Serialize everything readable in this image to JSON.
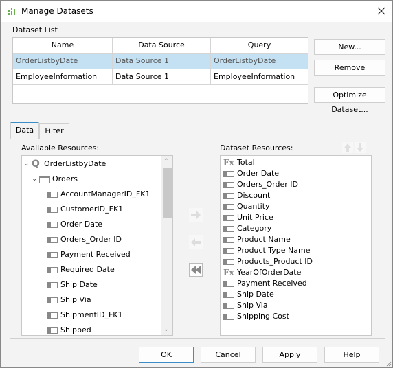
{
  "window": {
    "title": "Manage Datasets",
    "close_icon": "close-icon",
    "app_icon": "dataset-icon"
  },
  "dataset_list": {
    "label": "Dataset List",
    "columns": [
      "Name",
      "Data Source",
      "Query"
    ],
    "rows": [
      {
        "name": "OrderListbyDate",
        "source": "Data Source 1",
        "query": "OrderListbyDate",
        "selected": true
      },
      {
        "name": "EmployeeInformation",
        "source": "Data Source 1",
        "query": "EmployeeInformation",
        "selected": false
      }
    ]
  },
  "side_buttons": {
    "new": "New...",
    "remove": "Remove",
    "optimize": "Optimize Dataset..."
  },
  "tabs": [
    {
      "label": "Data",
      "active": true
    },
    {
      "label": "Filter",
      "active": false
    }
  ],
  "available": {
    "label": "Available Resources:",
    "query": "OrderListbyDate",
    "table": "Orders",
    "fields": [
      "AccountManagerID_FK1",
      "CustomerID_FK1",
      "Order Date",
      "Orders_Order ID",
      "Payment Received",
      "Required Date",
      "Ship Date",
      "Ship Via",
      "ShipmentID_FK1",
      "Shipped"
    ]
  },
  "dataset_resources": {
    "label": "Dataset Resources:",
    "items": [
      {
        "label": "Total",
        "type": "formula"
      },
      {
        "label": "Order Date",
        "type": "field"
      },
      {
        "label": "Orders_Order ID",
        "type": "field"
      },
      {
        "label": "Discount",
        "type": "field"
      },
      {
        "label": "Quantity",
        "type": "field"
      },
      {
        "label": "Unit Price",
        "type": "field"
      },
      {
        "label": "Category",
        "type": "field"
      },
      {
        "label": "Product Name",
        "type": "field"
      },
      {
        "label": "Product Type Name",
        "type": "field"
      },
      {
        "label": "Products_Product ID",
        "type": "field"
      },
      {
        "label": "YearOfOrderDate",
        "type": "formula"
      },
      {
        "label": "Payment Received",
        "type": "field"
      },
      {
        "label": "Ship Date",
        "type": "field"
      },
      {
        "label": "Ship Via",
        "type": "field"
      },
      {
        "label": "Shipping Cost",
        "type": "field"
      }
    ]
  },
  "footer": {
    "ok": "OK",
    "cancel": "Cancel",
    "apply": "Apply",
    "help": "Help"
  }
}
